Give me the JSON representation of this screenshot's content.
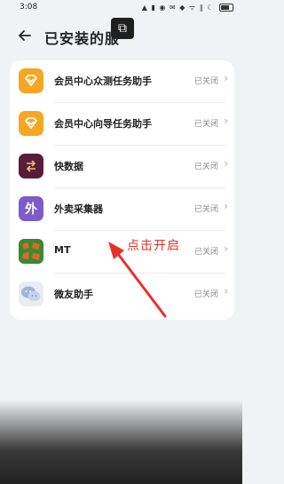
{
  "status_bar": {
    "time": "3:08",
    "icons": "▲ ▮ ◉ ✉ ◆ ᯤ ∥ ☾"
  },
  "header": {
    "title": "已安装的服",
    "back_icon": "arrow-left"
  },
  "float_icon": "⧉",
  "services": [
    {
      "name": "会员中心众测任务助手",
      "status": "已关闭",
      "icon": "diamond-icon",
      "color": "#f5a623"
    },
    {
      "name": "会员中心向导任务助手",
      "status": "已关闭",
      "icon": "diamond-icon",
      "color": "#f5a623"
    },
    {
      "name": "快数据",
      "status": "已关闭",
      "icon": "arrows-icon",
      "color": "#5b1c3a"
    },
    {
      "name": "外卖采集器",
      "status": "已关闭",
      "icon_text": "外",
      "color": "#7b5cc9"
    },
    {
      "name": "MT",
      "status": "已关闭",
      "icon": "mt-icon",
      "color": "#3a8a2e"
    },
    {
      "name": "微友助手",
      "status": "已关闭",
      "icon": "wechat-icon",
      "color": "#e8ecf3"
    }
  ],
  "annotation": {
    "text": "点击开启",
    "color": "#e8312a"
  }
}
